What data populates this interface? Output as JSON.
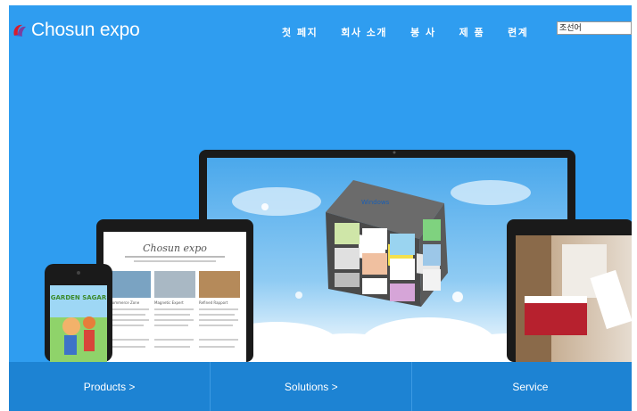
{
  "header": {
    "logo_text": "Chosun expo",
    "logo_icon": "chosun-logo-mark"
  },
  "nav": {
    "items": [
      {
        "label": "첫 페지"
      },
      {
        "label": "회사 소개"
      },
      {
        "label": "봉 사"
      },
      {
        "label": "제 품"
      },
      {
        "label": "련계"
      }
    ]
  },
  "language": {
    "selected": "조선어"
  },
  "tablet_screen": {
    "title": "Chosun expo",
    "columns": [
      "Commerce Zone",
      "Magnetic Expert",
      "Refined Rapport"
    ]
  },
  "phone_screen": {
    "title": "GARDEN SAGAR"
  },
  "cube": {
    "labels": [
      "Windows"
    ]
  },
  "bottom_tabs": [
    {
      "label": "Products  >"
    },
    {
      "label": "Solutions  >"
    },
    {
      "label": "Service"
    }
  ],
  "colors": {
    "background": "#2f9df0",
    "bottom_bar": "#1d83d3",
    "device_frame": "#1a1a1a"
  }
}
